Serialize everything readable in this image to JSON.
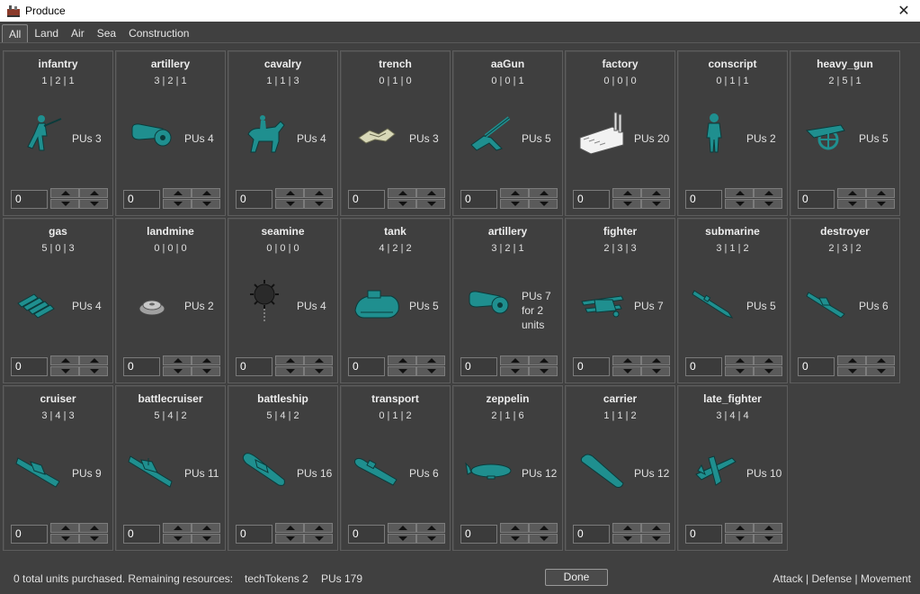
{
  "window": {
    "title": "Produce"
  },
  "tabs": [
    {
      "label": "All",
      "active": true
    },
    {
      "label": "Land"
    },
    {
      "label": "Air"
    },
    {
      "label": "Sea"
    },
    {
      "label": "Construction"
    }
  ],
  "units": [
    {
      "name": "infantry",
      "stats": "1 | 2 | 1",
      "cost": "PUs 3",
      "qty": "0",
      "icon": "infantry-icon"
    },
    {
      "name": "artillery",
      "stats": "3 | 2 | 1",
      "cost": "PUs 4",
      "qty": "0",
      "icon": "artillery-icon"
    },
    {
      "name": "cavalry",
      "stats": "1 | 1 | 3",
      "cost": "PUs 4",
      "qty": "0",
      "icon": "cavalry-icon"
    },
    {
      "name": "trench",
      "stats": "0 | 1 | 0",
      "cost": "PUs 3",
      "qty": "0",
      "icon": "trench-icon"
    },
    {
      "name": "aaGun",
      "stats": "0 | 0 | 1",
      "cost": "PUs 5",
      "qty": "0",
      "icon": "aagun-icon"
    },
    {
      "name": "factory",
      "stats": "0 | 0 | 0",
      "cost": "PUs 20",
      "qty": "0",
      "icon": "factory-icon"
    },
    {
      "name": "conscript",
      "stats": "0 | 1 | 1",
      "cost": "PUs 2",
      "qty": "0",
      "icon": "conscript-icon"
    },
    {
      "name": "heavy_gun",
      "stats": "2 | 5 | 1",
      "cost": "PUs 5",
      "qty": "0",
      "icon": "heavy-gun-icon"
    },
    {
      "name": "gas",
      "stats": "5 | 0 | 3",
      "cost": "PUs 4",
      "qty": "0",
      "icon": "gas-icon"
    },
    {
      "name": "landmine",
      "stats": "0 | 0 | 0",
      "cost": "PUs 2",
      "qty": "0",
      "icon": "landmine-icon"
    },
    {
      "name": "seamine",
      "stats": "0 | 0 | 0",
      "cost": "PUs 4",
      "qty": "0",
      "icon": "seamine-icon"
    },
    {
      "name": "tank",
      "stats": "4 | 2 | 2",
      "cost": "PUs 5",
      "qty": "0",
      "icon": "tank-icon"
    },
    {
      "name": "artillery",
      "stats": "3 | 2 | 1",
      "cost": "PUs 7",
      "cost2": "for 2",
      "cost3": "units",
      "qty": "0",
      "icon": "artillery-icon"
    },
    {
      "name": "fighter",
      "stats": "2 | 3 | 3",
      "cost": "PUs 7",
      "qty": "0",
      "icon": "fighter-biplane-icon"
    },
    {
      "name": "submarine",
      "stats": "3 | 1 | 2",
      "cost": "PUs 5",
      "qty": "0",
      "icon": "submarine-icon"
    },
    {
      "name": "destroyer",
      "stats": "2 | 3 | 2",
      "cost": "PUs 6",
      "qty": "0",
      "icon": "destroyer-icon"
    },
    {
      "name": "cruiser",
      "stats": "3 | 4 | 3",
      "cost": "PUs 9",
      "qty": "0",
      "icon": "cruiser-icon"
    },
    {
      "name": "battlecruiser",
      "stats": "5 | 4 | 2",
      "cost": "PUs 11",
      "qty": "0",
      "icon": "battlecruiser-icon"
    },
    {
      "name": "battleship",
      "stats": "5 | 4 | 2",
      "cost": "PUs 16",
      "qty": "0",
      "icon": "battleship-icon"
    },
    {
      "name": "transport",
      "stats": "0 | 1 | 2",
      "cost": "PUs 6",
      "qty": "0",
      "icon": "transport-icon"
    },
    {
      "name": "zeppelin",
      "stats": "2 | 1 | 6",
      "cost": "PUs 12",
      "qty": "0",
      "icon": "zeppelin-icon"
    },
    {
      "name": "carrier",
      "stats": "1 | 1 | 2",
      "cost": "PUs 12",
      "qty": "0",
      "icon": "carrier-icon"
    },
    {
      "name": "late_fighter",
      "stats": "3 | 4 | 4",
      "cost": "PUs 10",
      "qty": "0",
      "icon": "late-fighter-icon"
    }
  ],
  "footer": {
    "status": "0 total units purchased. Remaining resources:",
    "tech_tokens": "techTokens 2",
    "pus": "PUs 179",
    "done_label": "Done",
    "legend": "Attack | Defense | Movement"
  },
  "colors": {
    "unit_teal": "#1f8f8f",
    "background": "#404040",
    "card_border": "#5d5d5d"
  }
}
